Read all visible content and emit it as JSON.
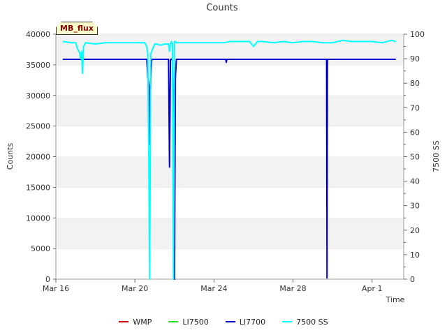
{
  "chart_data": {
    "type": "line",
    "title": "Counts",
    "site_label": "MB_flux",
    "xlabel": "Time",
    "ylabel": "Counts",
    "y2label": "7500 SS",
    "x_tick_labels": [
      "Mar 16",
      "Mar 20",
      "Mar 24",
      "Mar 28",
      "Apr 1"
    ],
    "x_tick_days": [
      0,
      4,
      8,
      12,
      16
    ],
    "xlim_days": [
      0,
      17.6
    ],
    "y_ticks": [
      0,
      5000,
      10000,
      15000,
      20000,
      25000,
      30000,
      35000,
      40000
    ],
    "ylim": [
      0,
      40000
    ],
    "y2_ticks": [
      0,
      10,
      20,
      30,
      40,
      50,
      60,
      70,
      80,
      90,
      100
    ],
    "y2lim": [
      0,
      100
    ],
    "grid": "horizontal bands",
    "legend_position": "bottom",
    "series": [
      {
        "name": "WMP",
        "color": "#cc0000",
        "axis": "left",
        "x_days": [],
        "values": []
      },
      {
        "name": "LI7500",
        "color": "#22dd22",
        "axis": "left",
        "x_days": [],
        "values": []
      },
      {
        "name": "LI7700",
        "color": "#0000cc",
        "axis": "left",
        "x_days": [
          0.35,
          4.6,
          4.65,
          4.72,
          4.75,
          4.8,
          4.85,
          4.9,
          5.6,
          5.7,
          5.75,
          5.8,
          5.85,
          5.9,
          5.95,
          6.0,
          6.05,
          6.1,
          6.15,
          6.2,
          8.6,
          8.62,
          8.66,
          8.7,
          13.7,
          13.72,
          13.74,
          13.76,
          17.2
        ],
        "values": [
          35900,
          35900,
          33000,
          31500,
          22000,
          33000,
          35900,
          35900,
          35900,
          35900,
          18300,
          35900,
          35900,
          36000,
          20000,
          0,
          33000,
          35900,
          35900,
          35900,
          35900,
          35400,
          35900,
          35900,
          35900,
          200,
          35900,
          35900,
          35900
        ]
      },
      {
        "name": "7500 SS",
        "color": "#00ffff",
        "axis": "right",
        "x_days": [
          0.35,
          0.8,
          1.0,
          1.1,
          1.2,
          1.25,
          1.3,
          1.35,
          1.4,
          1.5,
          2.0,
          2.5,
          3.0,
          3.5,
          4.0,
          4.5,
          4.6,
          4.65,
          4.7,
          4.75,
          4.8,
          4.85,
          4.9,
          4.95,
          5.0,
          5.1,
          5.3,
          5.5,
          5.7,
          5.75,
          5.8,
          5.85,
          5.9,
          5.95,
          6.0,
          6.05,
          6.1,
          6.5,
          7.0,
          7.5,
          8.0,
          8.5,
          8.8,
          9.0,
          9.5,
          9.8,
          10.0,
          10.2,
          10.5,
          11.0,
          11.5,
          12.0,
          12.5,
          13.0,
          13.5,
          14.0,
          14.5,
          15.0,
          15.5,
          16.0,
          16.5,
          17.0,
          17.2
        ],
        "values": [
          97,
          96.5,
          96.5,
          94,
          92.5,
          90,
          93,
          84,
          95,
          96.5,
          96,
          96.5,
          96.5,
          96.5,
          96.5,
          96.5,
          95,
          92,
          50,
          0,
          92,
          93,
          94,
          95,
          96,
          96,
          95.5,
          96,
          96,
          93,
          96,
          97,
          96,
          0,
          97,
          97,
          96.5,
          96.5,
          96.5,
          96.5,
          96.5,
          96.5,
          97,
          97,
          97,
          97,
          95,
          97,
          97,
          96.5,
          97,
          96.5,
          97,
          97,
          96.5,
          96.5,
          97.5,
          97,
          97,
          97,
          96.5,
          97.5,
          97
        ]
      }
    ]
  }
}
